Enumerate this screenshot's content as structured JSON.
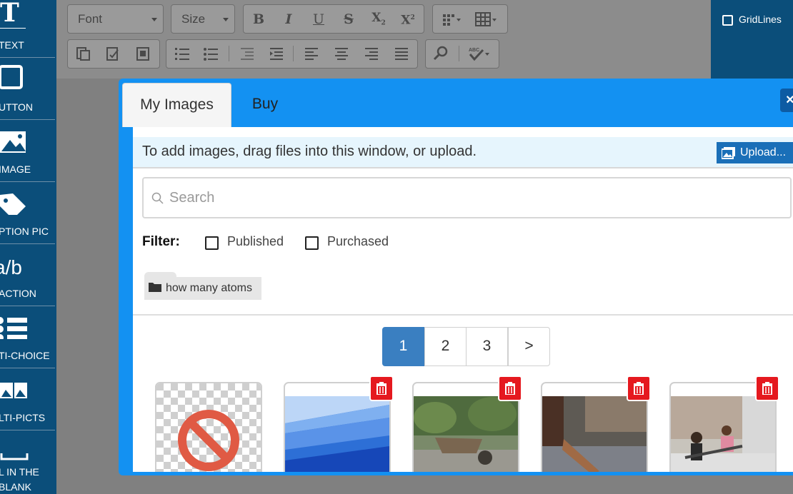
{
  "sidebar": {
    "items": [
      {
        "label": "TEXT",
        "icon": "text-icon"
      },
      {
        "label": "UTTON",
        "icon": "button-icon"
      },
      {
        "label": "IMAGE",
        "icon": "image-icon"
      },
      {
        "label": "PTION PIC",
        "icon": "tag-icon"
      },
      {
        "label": "ACTION",
        "icon": "fraction-icon"
      },
      {
        "label": "TI-CHOICE",
        "icon": "list-icon"
      },
      {
        "label": "LTI-PICTS",
        "icon": "pictures-icon"
      },
      {
        "label": "L IN THE",
        "label2": "BLANK",
        "icon": "blank-icon"
      }
    ]
  },
  "toolbar": {
    "font_label": "Font",
    "size_label": "Size",
    "bold": "B",
    "italic": "I",
    "underline": "U",
    "strike": "S",
    "subscript": "X",
    "superscript": "X",
    "sub_mark": "2",
    "sup_mark": "2"
  },
  "gridlines": {
    "label": "GridLines",
    "checked": false
  },
  "dialog": {
    "tabs": [
      {
        "label": "My Images",
        "active": true
      },
      {
        "label": "Buy",
        "active": false
      }
    ],
    "close_label": "×",
    "drop_text": "To add images, drag files into this window, or upload.",
    "upload_label": "Upload...",
    "search": {
      "placeholder": "Search",
      "value": ""
    },
    "filter": {
      "label": "Filter:",
      "options": [
        {
          "label": "Published",
          "checked": false
        },
        {
          "label": "Purchased",
          "checked": false
        }
      ]
    },
    "folder": {
      "label": "how many atoms"
    },
    "pagination": {
      "pages": [
        "1",
        "2",
        "3"
      ],
      "next": ">",
      "current": "1"
    }
  },
  "colors": {
    "sidebar": "#0b4e7a",
    "dialog_frame": "#1391f2",
    "active_page": "#3a7fc1",
    "delete": "#e5191f",
    "upload": "#1a6fb8"
  }
}
